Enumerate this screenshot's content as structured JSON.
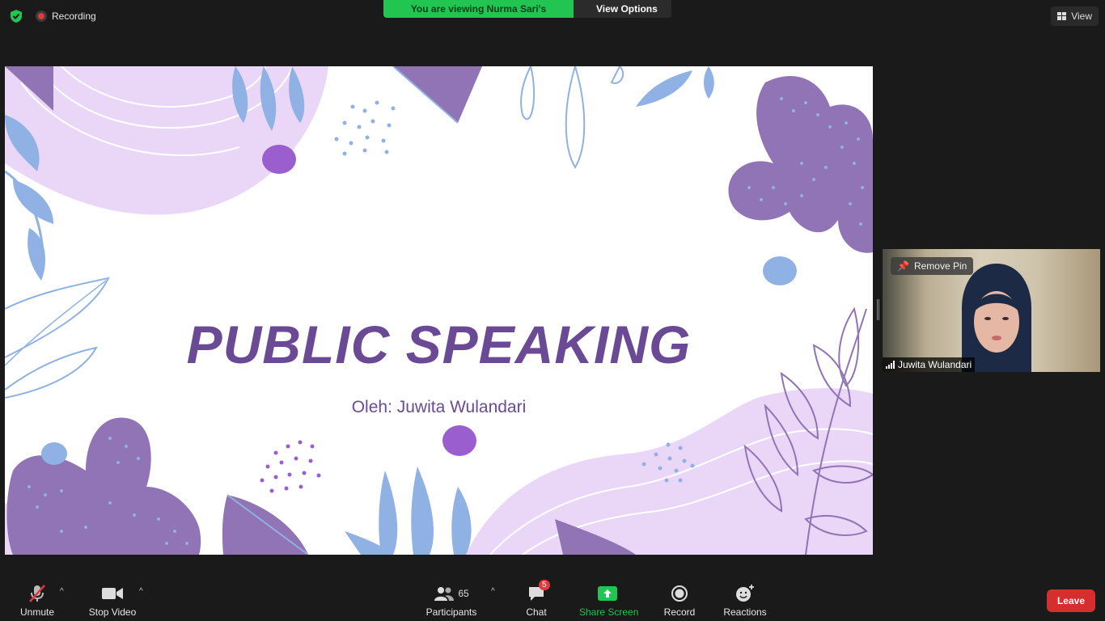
{
  "topbar": {
    "recording_label": "Recording",
    "viewing_banner": "You are viewing Nurma Sari's screen",
    "view_options_label": "View Options",
    "view_label": "View"
  },
  "slide": {
    "title": "PUBLIC SPEAKING",
    "subtitle": "Oleh: Juwita Wulandari"
  },
  "video_tile": {
    "remove_pin_label": "Remove Pin",
    "participant_name": "Juwita Wulandari"
  },
  "toolbar": {
    "unmute_label": "Unmute",
    "stop_video_label": "Stop Video",
    "participants_label": "Participants",
    "participants_count": "65",
    "chat_label": "Chat",
    "chat_badge": "5",
    "share_screen_label": "Share Screen",
    "record_label": "Record",
    "reactions_label": "Reactions",
    "leave_label": "Leave"
  },
  "colors": {
    "share_green": "#23c552",
    "leave_red": "#d62e2e",
    "slide_purple": "#6a4a95",
    "lilac": "#ead7f7",
    "blob_purple": "#9174b5",
    "leaf_blue": "#8fb1e3"
  }
}
